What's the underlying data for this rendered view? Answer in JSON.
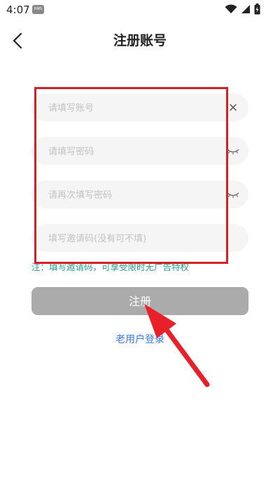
{
  "status_bar": {
    "time": "4:07",
    "hms_badge": "HMS",
    "icons": [
      "wifi-icon",
      "signal-icon",
      "battery-icon"
    ]
  },
  "header": {
    "title": "注册账号",
    "back_icon": "chevron-left-icon"
  },
  "form": {
    "account": {
      "value": "",
      "placeholder": "请填写账号",
      "icon": "clear-icon"
    },
    "password": {
      "value": "",
      "placeholder": "请填写密码",
      "icon": "eye-closed-icon"
    },
    "password_confirm": {
      "value": "",
      "placeholder": "请再次填写密码",
      "icon": "eye-closed-icon"
    },
    "invite_code": {
      "value": "",
      "placeholder": "填写邀请码(没有可不填)"
    }
  },
  "notice": "注：填写邀请码，可享受限时无广告特权",
  "register_button": "注册",
  "login_link": "老用户登录",
  "colors": {
    "field_bg": "#f5f5f5",
    "button_disabled": "#ababab",
    "link": "#3a78f0",
    "notice": "#2a9d8f",
    "annotation": "#d42027"
  }
}
